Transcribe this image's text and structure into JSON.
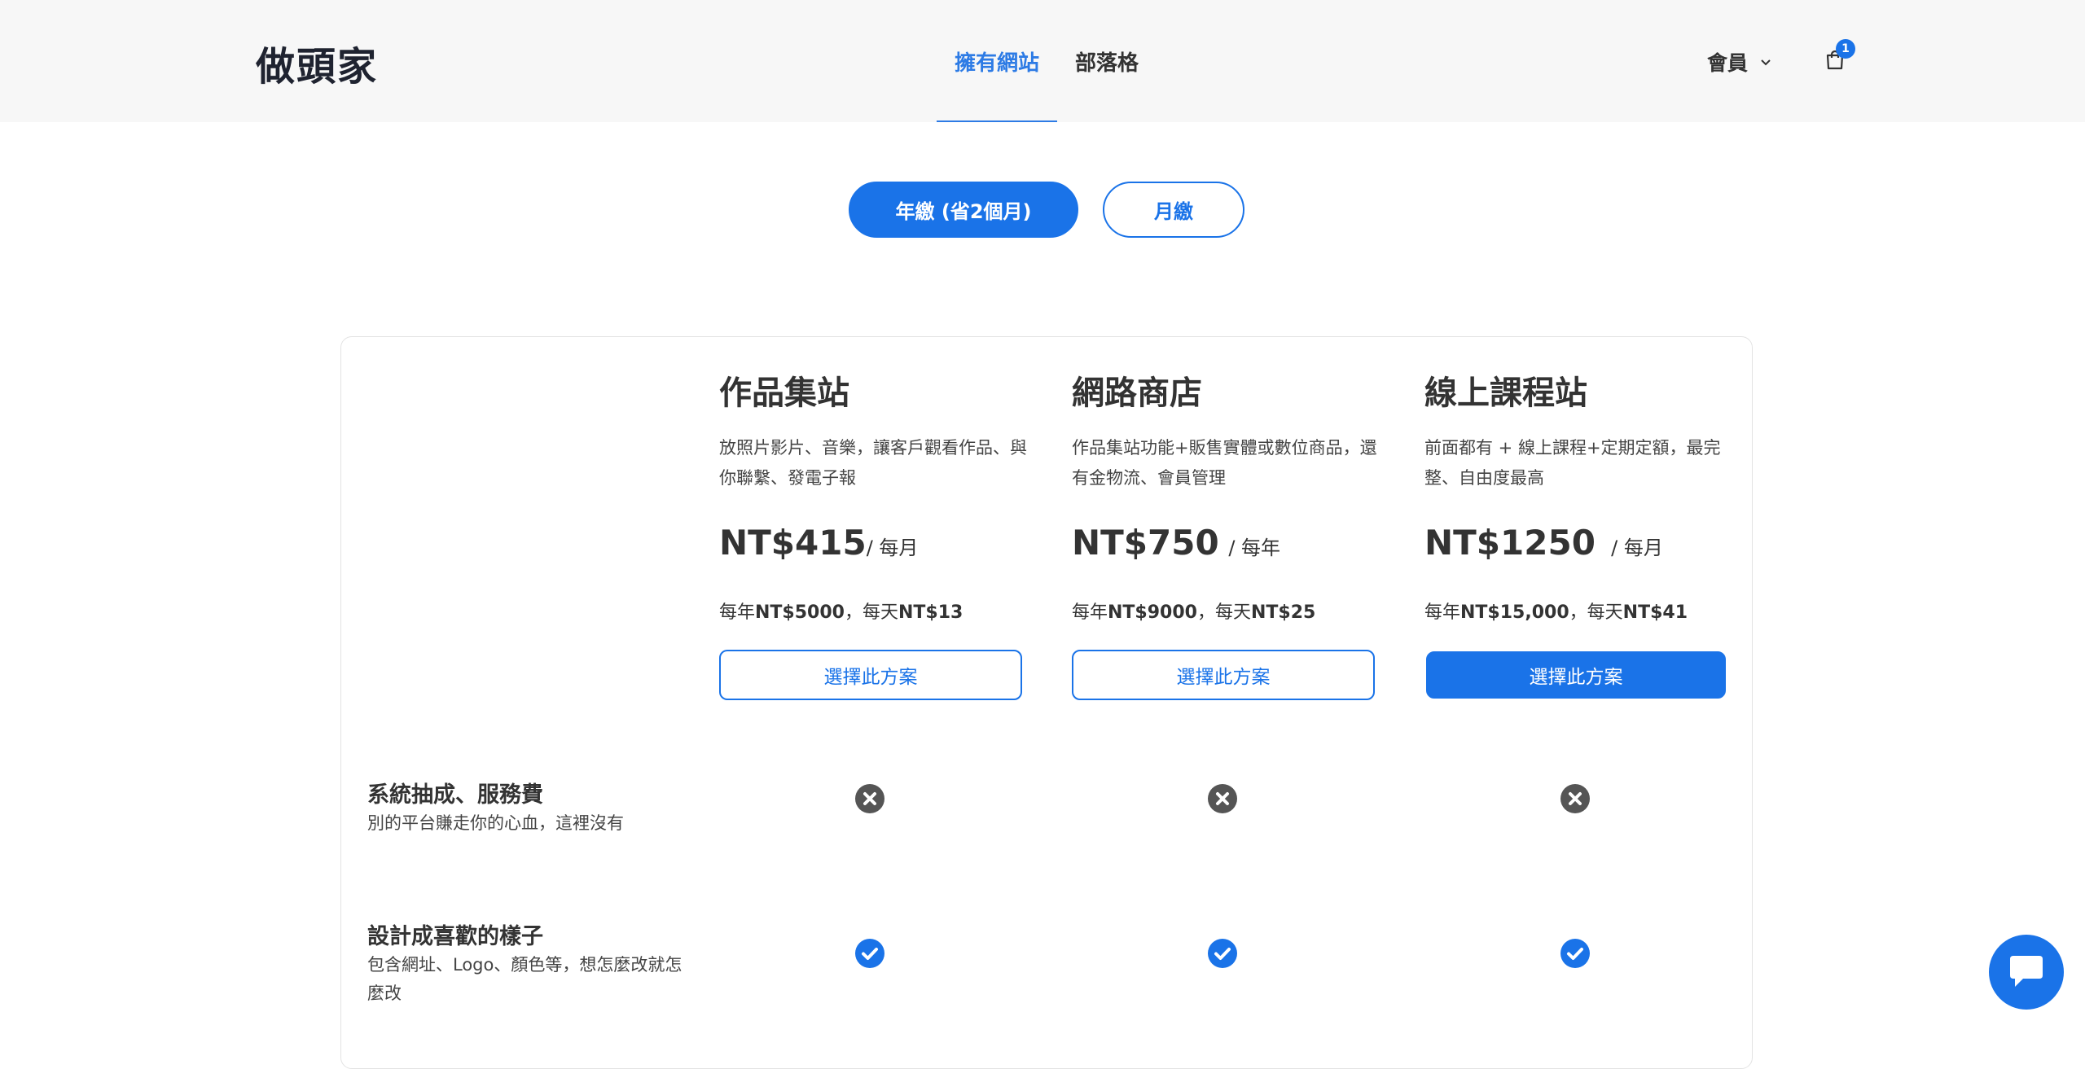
{
  "header": {
    "brand": "做頭家",
    "nav": [
      {
        "label": "擁有網站",
        "active": true
      },
      {
        "label": "部落格",
        "active": false
      }
    ],
    "member_label": "會員",
    "cart_count": "1"
  },
  "billing": {
    "annual_label": "年繳 (省2個月)",
    "monthly_label": "月繳",
    "selected": "annual"
  },
  "plans": [
    {
      "name": "作品集站",
      "desc": "放照片影片、音樂，讓客戶觀看作品、與你聯繫、發電子報",
      "price": "NT$415",
      "period": "/ 每月",
      "yearly_prefix": "每年",
      "yearly_amount": "NT$5000",
      "daily_prefix": "，每天",
      "daily_amount": "NT$13",
      "button": "選擇此方案",
      "highlight": false
    },
    {
      "name": "網路商店",
      "desc": "作品集站功能+販售實體或數位商品，還有金物流、會員管理",
      "price": "NT$750",
      "period": " / 每年",
      "yearly_prefix": "每年",
      "yearly_amount": "NT$9000",
      "daily_prefix": "，每天",
      "daily_amount": "NT$25",
      "button": "選擇此方案",
      "highlight": false
    },
    {
      "name": "線上課程站",
      "desc": "前面都有 + 線上課程+定期定額，最完整、自由度最高",
      "price": "NT$1250",
      "period": "  / 每月",
      "yearly_prefix": "每年",
      "yearly_amount": "NT$15,000",
      "daily_prefix": "，每天",
      "daily_amount": "NT$41",
      "button": "選擇此方案",
      "highlight": true
    }
  ],
  "features": [
    {
      "title": "系統抽成、服務費",
      "desc": "別的平台賺走你的心血，這裡沒有",
      "values": [
        "x-circle-icon",
        "x-circle-icon",
        "x-circle-icon"
      ]
    },
    {
      "title": "設計成喜歡的樣子",
      "desc": "包含網址、Logo、顏色等，想怎麼改就怎麼改",
      "values": [
        "check-circle-icon",
        "check-circle-icon",
        "check-circle-icon"
      ]
    }
  ],
  "colors": {
    "accent": "#1a73e8",
    "nav_active": "#2d7be5",
    "header_bg": "#f7f7f7",
    "x_icon": "#555555"
  }
}
